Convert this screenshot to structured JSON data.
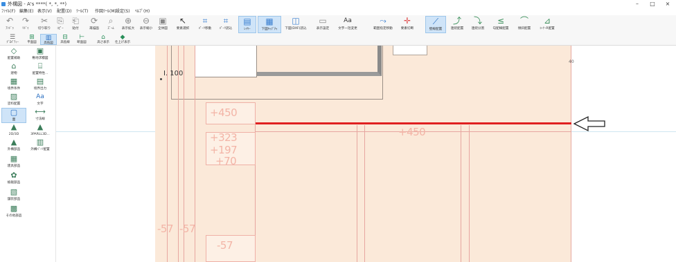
{
  "window": {
    "title": "外構図 - A's ****( *, *, **)",
    "buttons": [
      "–",
      "□",
      "×"
    ]
  },
  "menu": [
    "ﾌｧｲﾙ(F)",
    "編集(E)",
    "表示(V)",
    "配置(D)",
    "ﾂｰﾙ(T)",
    "作図ﾂｰﾙ(M)",
    "設定(S)",
    "ﾍﾙﾌﾟ(H)"
  ],
  "toolbar": [
    {
      "icon": "undo-icon",
      "glyph": "↶",
      "label": "ｱﾝﾄﾞｩ"
    },
    {
      "icon": "redo-icon",
      "glyph": "↷",
      "label": "ﾘﾄﾞｩ"
    },
    {
      "icon": "cut-icon",
      "glyph": "✂",
      "label": "切り取り"
    },
    {
      "icon": "copy-icon",
      "glyph": "⎘",
      "label": "ｺﾋﾟｰ"
    },
    {
      "icon": "paste-icon",
      "glyph": "⎗",
      "label": "貼付"
    },
    {
      "icon": "redraw-icon",
      "glyph": "⟳",
      "label": "再描画"
    },
    {
      "icon": "zoom-icon",
      "glyph": "⌕",
      "label": "ｽﾞｰﾑ"
    },
    {
      "icon": "zoom-in-icon",
      "glyph": "⊕",
      "label": "表示拡大"
    },
    {
      "icon": "zoom-out-icon",
      "glyph": "⊖",
      "label": "表示縮小"
    },
    {
      "icon": "fit-icon",
      "glyph": "▣",
      "label": "全体図"
    },
    {
      "icon": "select-icon",
      "glyph": "↖",
      "label": "要素選択"
    },
    {
      "icon": "part-move-icon",
      "glyph": "⌗",
      "label": "ﾊﾟｰﾂ移動"
    },
    {
      "icon": "part-read-icon",
      "glyph": "⌗",
      "label": "ﾊﾟｰﾂ読込"
    },
    {
      "icon": "layer-icon",
      "glyph": "▤",
      "label": "ﾚｲﾔｰ"
    },
    {
      "icon": "underlay-cap-icon",
      "glyph": "▦",
      "label": "下図ｷｬﾌﾟﾁｬ"
    },
    {
      "icon": "underlay-dxf-icon",
      "glyph": "◫",
      "label": "下図(DXF)読込"
    },
    {
      "icon": "display-icon",
      "glyph": "▭",
      "label": "表示設定"
    },
    {
      "icon": "text-batch-icon",
      "glyph": "Aa",
      "label": "文字一括変更"
    },
    {
      "icon": "range-move-icon",
      "glyph": "⤳",
      "label": "範囲指定移動"
    },
    {
      "icon": "cut-tool-icon",
      "glyph": "✛",
      "label": "要素切断"
    },
    {
      "icon": "wall-icon",
      "glyph": "⟋",
      "label": "壁線配置"
    },
    {
      "icon": "link-place-icon",
      "glyph": "⤴",
      "label": "連続配置"
    },
    {
      "icon": "link-split-icon",
      "glyph": "⤵",
      "label": "連続分割"
    },
    {
      "icon": "slope-icon",
      "glyph": "≤",
      "label": "勾配線配置"
    },
    {
      "icon": "step-icon",
      "glyph": "⌒",
      "label": "傾斜配置"
    },
    {
      "icon": "corner-icon",
      "glyph": "⊿",
      "label": "ｺｰﾅｰR配置"
    }
  ],
  "toolbar2": [
    {
      "icon": "property-icon",
      "glyph": "☰",
      "label": "ﾌﾟﾛﾊﾟﾃｨｰ"
    },
    {
      "icon": "plan-icon",
      "glyph": "⊞",
      "label": "平面図"
    },
    {
      "icon": "elev-icon",
      "glyph": "▥",
      "label": "高低図"
    },
    {
      "icon": "elev-line-icon",
      "glyph": "⊟",
      "label": "高低線"
    },
    {
      "icon": "section-icon",
      "glyph": "⊢",
      "label": "断面図"
    },
    {
      "icon": "elev-show-icon",
      "glyph": "⌂",
      "label": "高さ表示"
    },
    {
      "icon": "finish-icon",
      "glyph": "◆",
      "label": "仕上げ表示"
    }
  ],
  "sidebar": [
    {
      "icon": "boundary-icon",
      "glyph": "◇",
      "label": "配置補助"
    },
    {
      "icon": "ground-icon",
      "glyph": "▣",
      "label": "敷地求積図"
    },
    {
      "icon": "building-icon",
      "glyph": "⌂",
      "label": "建物"
    },
    {
      "icon": "building-info-icon",
      "glyph": "⌸",
      "label": "配置特性..."
    },
    {
      "icon": "border-icon",
      "glyph": "▦",
      "label": "境界条件"
    },
    {
      "icon": "boundary-out-icon",
      "glyph": "▤",
      "label": "境界出力"
    },
    {
      "icon": "paint-icon",
      "glyph": "▨",
      "label": "塗料配置"
    },
    {
      "icon": "text-icon",
      "glyph": "Aa",
      "label": "文字"
    },
    {
      "icon": "surface-icon",
      "glyph": "▢",
      "label": "面"
    },
    {
      "icon": "dimension-icon",
      "glyph": "⟷",
      "label": "寸法線"
    },
    {
      "icon": "image-2d-icon",
      "glyph": "▲",
      "label": "2D/3D"
    },
    {
      "icon": "image-3d-icon",
      "glyph": "▲",
      "label": "3PARLL3D..."
    },
    {
      "icon": "exterior-icon",
      "glyph": "▲",
      "label": "外構部品"
    },
    {
      "icon": "exterior-place-icon",
      "glyph": "▥",
      "label": "外構ﾊﾟｰﾂ配置"
    },
    {
      "icon": "furniture-icon",
      "glyph": "▦",
      "label": "建具部品"
    },
    {
      "icon": "plant-icon",
      "glyph": "✿",
      "label": "植栽部品"
    },
    {
      "icon": "pavement-icon",
      "glyph": "▧",
      "label": "舗装部品"
    },
    {
      "icon": "other-icon",
      "glyph": "▩",
      "label": "その他部品"
    }
  ],
  "canvas": {
    "level_label": "I. 100",
    "dims": [
      "+450",
      "+323",
      "+197",
      "+70",
      "+450",
      "-57",
      "-57",
      "-57"
    ],
    "corner_mark": "40",
    "colors": {
      "ground": "#fbe9d9",
      "accent_line": "#e02020",
      "dim_text": "#f3b4a6"
    }
  }
}
